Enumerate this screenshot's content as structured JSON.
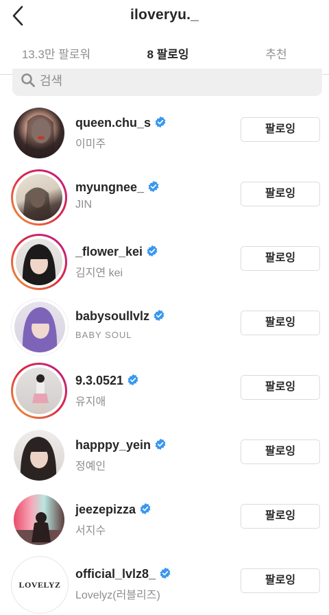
{
  "header": {
    "title": "iloveryu._"
  },
  "tabs": [
    {
      "label": "13.3만 팔로워"
    },
    {
      "label": "8 팔로잉"
    },
    {
      "label": "추천"
    }
  ],
  "search": {
    "placeholder": "검색"
  },
  "accounts": [
    {
      "username": "queen.chu_s",
      "name": "이미주",
      "button": "팔로잉",
      "story_ring": false
    },
    {
      "username": "myungnee_",
      "name": "JIN",
      "button": "팔로잉",
      "story_ring": true
    },
    {
      "username": "_flower_kei",
      "name": "김지연 kei",
      "button": "팔로잉",
      "story_ring": true
    },
    {
      "username": "babysoullvlz",
      "name": "BABY SOUL",
      "button": "팔로잉",
      "story_ring": false
    },
    {
      "username": "9.3.0521",
      "name": "유지애",
      "button": "팔로잉",
      "story_ring": true
    },
    {
      "username": "happpy_yein",
      "name": "정예인",
      "button": "팔로잉",
      "story_ring": false
    },
    {
      "username": "jeezepizza",
      "name": "서지수",
      "button": "팔로잉",
      "story_ring": false
    },
    {
      "username": "official_lvlz8_",
      "name": "Lovelyz(러블리즈)",
      "button": "팔로잉",
      "story_ring": false,
      "avatar_text": "LOVELYZ"
    }
  ],
  "colors": {
    "verified": "#3897f0",
    "text": "#262626",
    "secondary": "#8e8e8e",
    "border": "#dbdbdb"
  }
}
